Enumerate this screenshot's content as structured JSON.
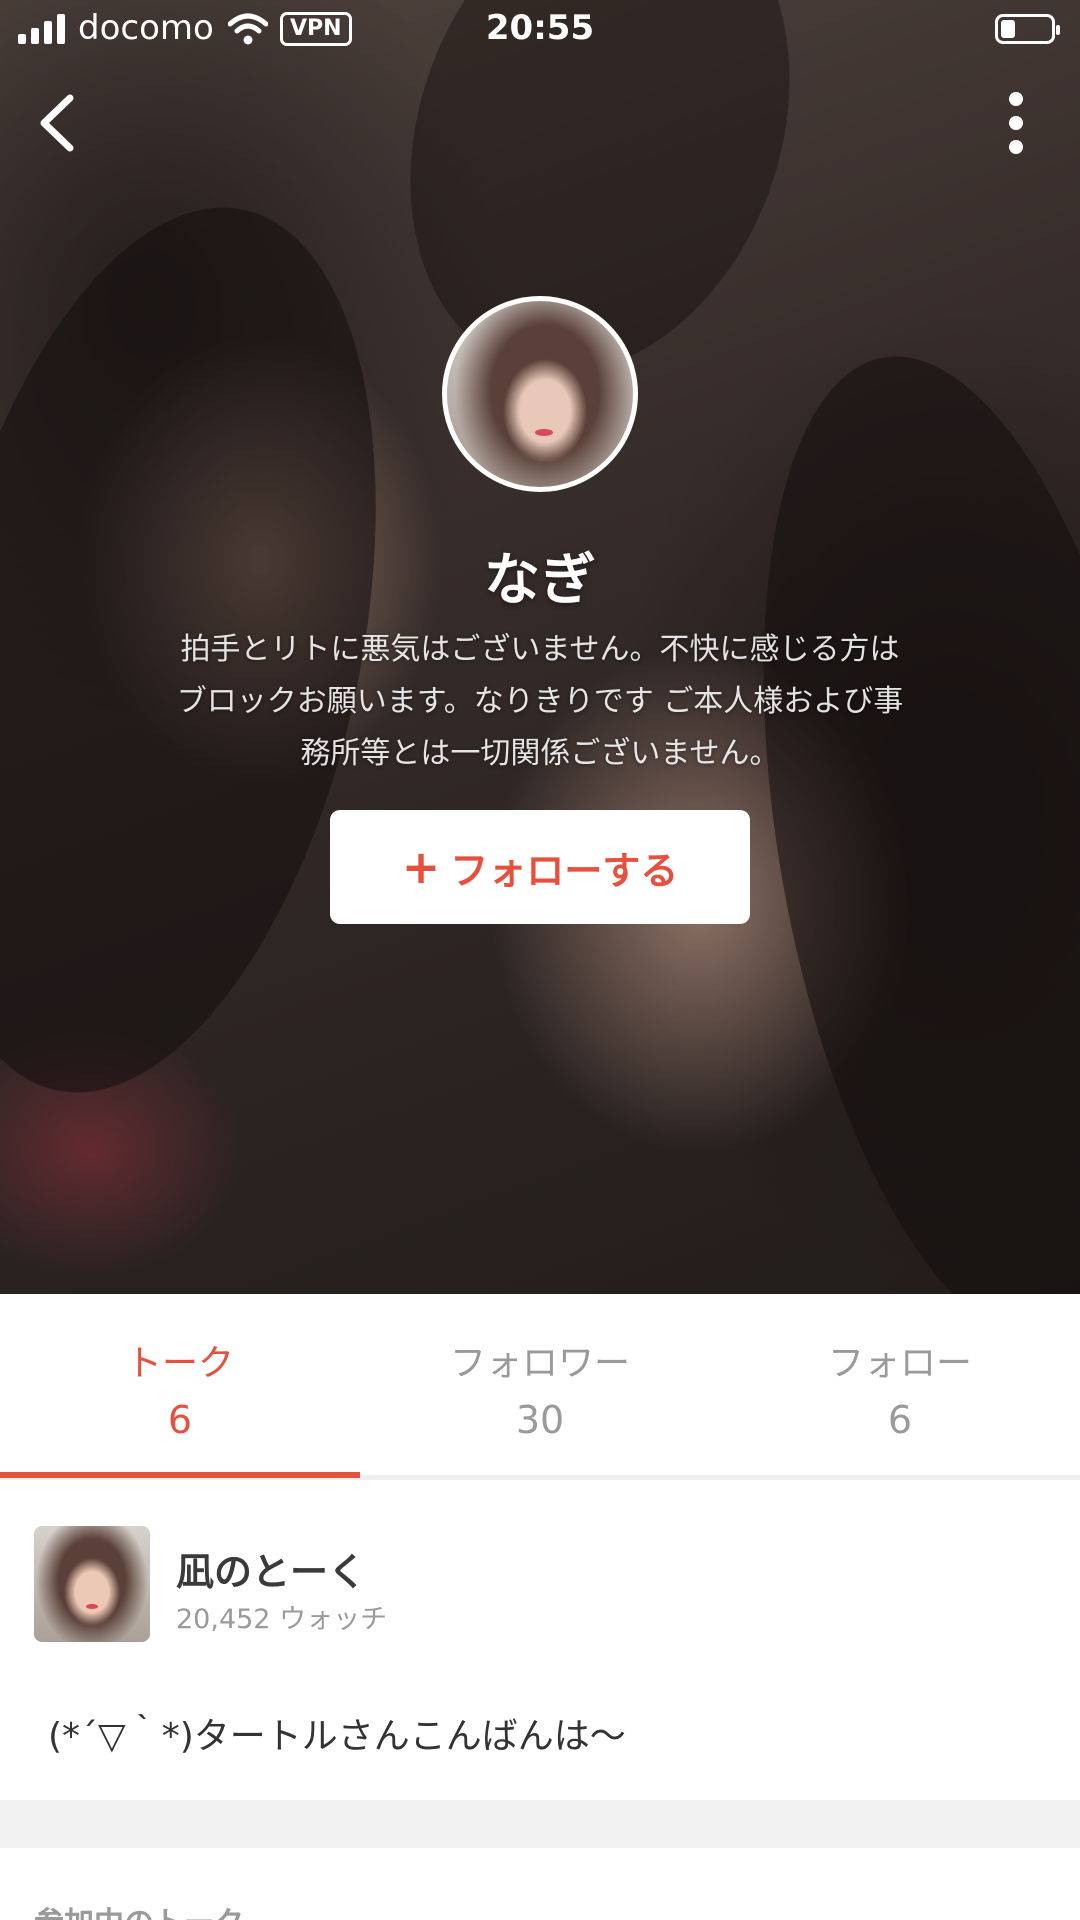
{
  "status_bar": {
    "carrier": "docomo",
    "vpn": "VPN",
    "time": "20:55"
  },
  "profile": {
    "name": "なぎ",
    "bio_lines": [
      "拍手とリトに悪気はございません。不快に感じる方は",
      "ブロックお願います。なりきりです ご本人様および事",
      "務所等とは一切関係ございません。"
    ],
    "follow_label": "フォローする",
    "follow_icon": "+"
  },
  "tabs": [
    {
      "label": "トーク",
      "count": "6",
      "active": true
    },
    {
      "label": "フォロワー",
      "count": "30",
      "active": false
    },
    {
      "label": "フォロー",
      "count": "6",
      "active": false
    }
  ],
  "talk": {
    "title": "凪のとーく",
    "watch_count": "20,452",
    "watch_label": "ウォッチ",
    "message": "(*´▽｀*)タートルさんこんばんは〜"
  },
  "section": {
    "title": "参加中のトーク"
  },
  "colors": {
    "accent": "#e8503e",
    "muted": "#9a9a9a"
  },
  "icons": {
    "back": "back-chevron-icon",
    "more": "more-vertical-icon"
  }
}
